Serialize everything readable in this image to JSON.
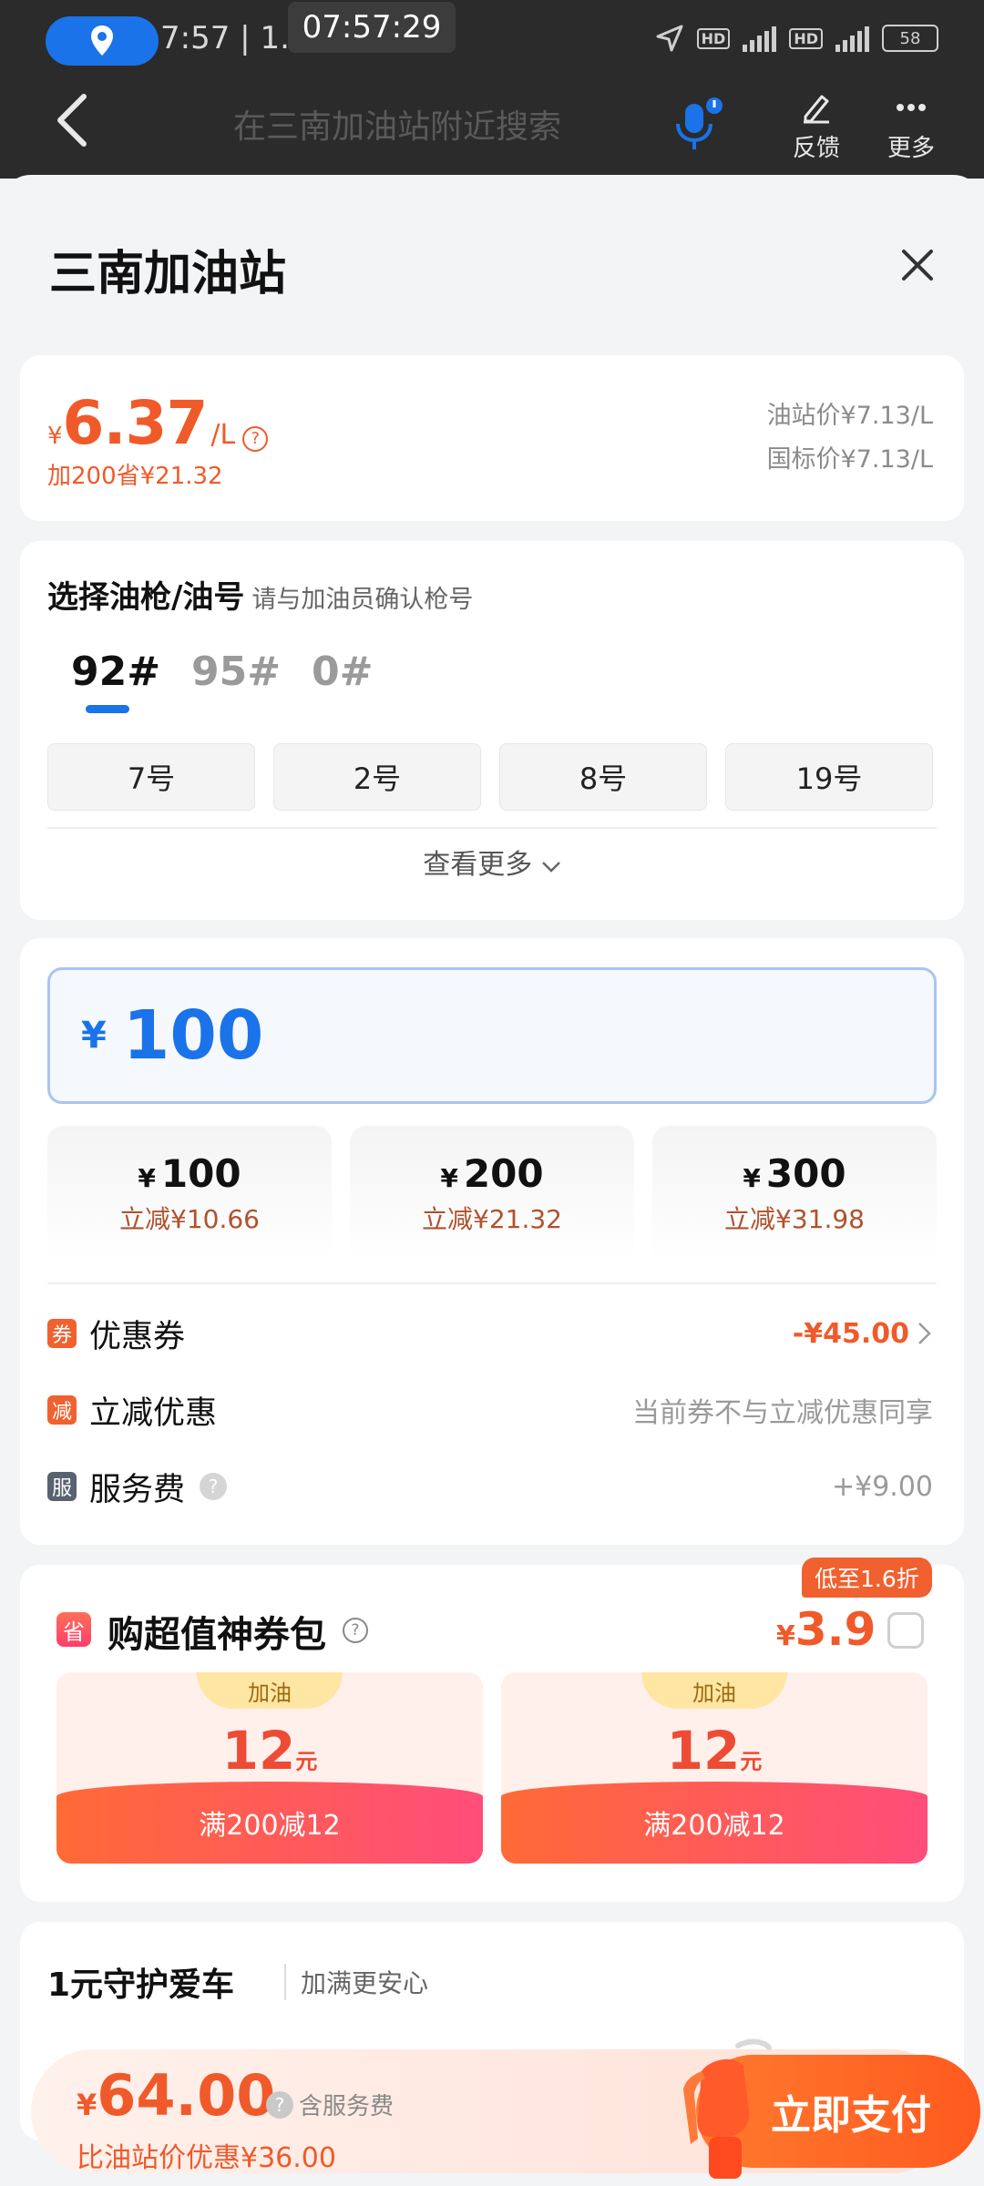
{
  "status": {
    "time": "7:57",
    "net_speed": "1.1K/s",
    "clock": "07:57:29",
    "battery": "58"
  },
  "nav": {
    "search_placeholder": "在三南加油站附近搜索",
    "feedback_label": "反馈",
    "more_label": "更多"
  },
  "sheet": {
    "title": "三南加油站"
  },
  "price": {
    "currency": "¥",
    "value": "6.37",
    "unit": "/L",
    "save_text": "加200省¥21.32",
    "station_price": "油站价¥7.13/L",
    "national_price": "国标价¥7.13/L"
  },
  "nozzle": {
    "title": "选择油枪/油号",
    "hint": "请与加油员确认枪号",
    "fuel_tabs": [
      "92#",
      "95#",
      "0#"
    ],
    "selected_tab": "92#",
    "guns": [
      "7号",
      "2号",
      "8号",
      "19号"
    ],
    "see_more": "查看更多"
  },
  "amount": {
    "currency": "¥",
    "value": "100",
    "presets": [
      {
        "amount": "100",
        "discount": "立减¥10.66"
      },
      {
        "amount": "200",
        "discount": "立减¥21.32"
      },
      {
        "amount": "300",
        "discount": "立减¥31.98"
      }
    ],
    "coupon": {
      "badge": "券",
      "label": "优惠券",
      "value": "-¥45.00"
    },
    "instant": {
      "badge": "减",
      "label": "立减优惠",
      "value": "当前券不与立减优惠同享"
    },
    "service": {
      "badge": "服",
      "label": "服务费",
      "value": "+¥9.00"
    }
  },
  "pack": {
    "badge": "省",
    "title": "购超值神券包",
    "tag": "低至1.6折",
    "currency": "¥",
    "price": "3.9",
    "coupons": [
      {
        "tag": "加油",
        "amount": "12",
        "unit": "元",
        "condition": "满200减12"
      },
      {
        "tag": "加油",
        "amount": "12",
        "unit": "元",
        "condition": "满200减12"
      }
    ]
  },
  "protect": {
    "title": "1元守护爱车",
    "subtitle": "加满更安心"
  },
  "pay": {
    "currency": "¥",
    "total": "64.00",
    "note": "含服务费",
    "save": "比油站价优惠¥36.00",
    "button": "立即支付"
  },
  "colors": {
    "accent_blue": "#1a73e8",
    "price_orange": "#f05a2a",
    "pay_button": "#ff6a24"
  }
}
